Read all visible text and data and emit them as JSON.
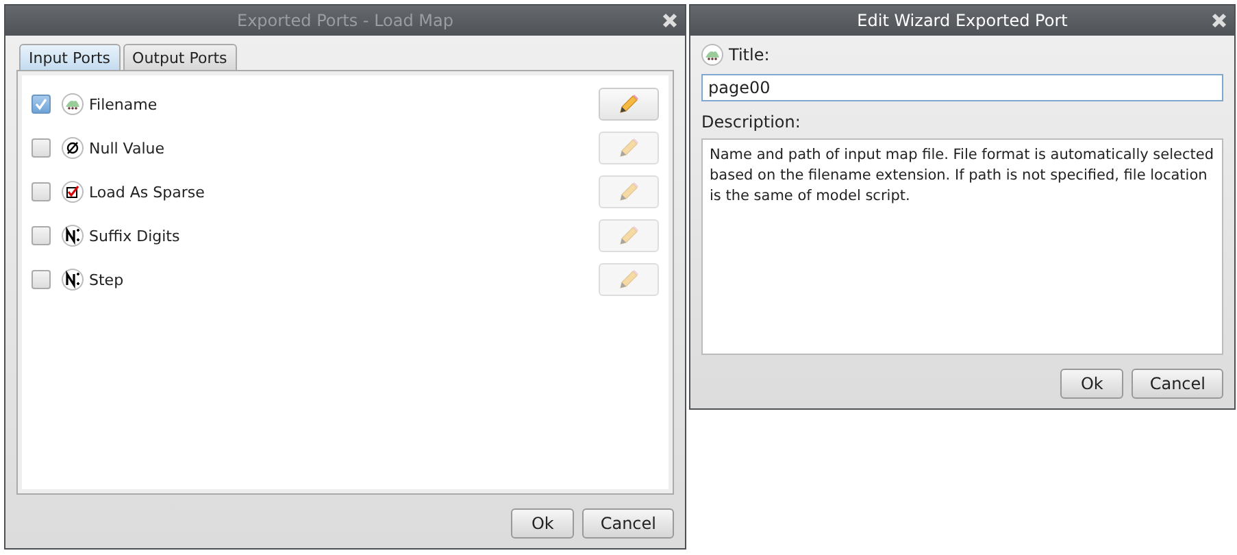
{
  "ports_dialog": {
    "title": "Exported Ports - Load Map",
    "active": false,
    "tabs": [
      {
        "label": "Input Ports",
        "selected": true
      },
      {
        "label": "Output Ports",
        "selected": false
      }
    ],
    "ports": [
      {
        "label": "Filename",
        "kind": "map",
        "checked": true,
        "edit_disabled": false
      },
      {
        "label": "Null Value",
        "kind": "null",
        "checked": false,
        "edit_disabled": true
      },
      {
        "label": "Load As Sparse",
        "kind": "bool",
        "checked": false,
        "edit_disabled": true
      },
      {
        "label": "Suffix Digits",
        "kind": "number",
        "checked": false,
        "edit_disabled": true
      },
      {
        "label": "Step",
        "kind": "number",
        "checked": false,
        "edit_disabled": true
      }
    ],
    "buttons": [
      "Ok",
      "Cancel"
    ]
  },
  "edit_dialog": {
    "title": "Edit Wizard Exported Port",
    "active": true,
    "title_label": {
      "text": "Title:",
      "kind": "map"
    },
    "title_value": "page00",
    "description_label": "Description:",
    "description": "Name and path of input map file. File format is automatically selected based on the filename extension. If path is not specified, file location is the same of model script.",
    "buttons": [
      "Ok",
      "Cancel"
    ]
  }
}
